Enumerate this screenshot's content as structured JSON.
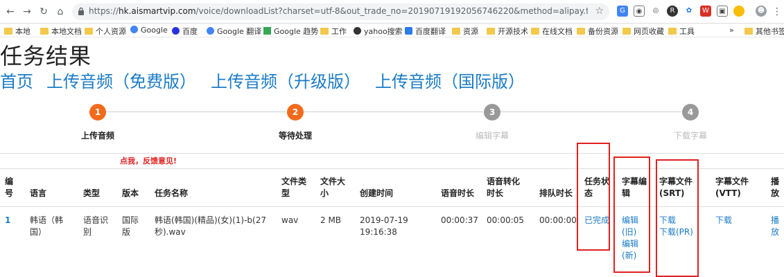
{
  "browser": {
    "url_prefix": "https://",
    "url_host": "hk.aismartvip.com",
    "url_rest": "/voice/downloadList?charset=utf-8&out_trade_no=20190719192056746220&method=alipay.trade.page.pay.return...",
    "bookmarks": [
      "本地",
      "本地文档",
      "个人资源",
      "Google",
      "百度",
      "Google 翻译",
      "Google 趋势",
      "工作",
      "yahoo搜索",
      "百度翻译",
      "资源",
      "开源技术",
      "在线文档",
      "备份资源",
      "网页收藏",
      "工具"
    ],
    "overflow": "»",
    "other_bookmarks": "其他书签"
  },
  "page": {
    "title": "任务结果",
    "nav": [
      "首页",
      "上传音频（免费版）",
      "上传音频（升级版）",
      "上传音频（国际版）"
    ]
  },
  "steps": [
    {
      "num": "1",
      "label": "上传音频",
      "state": "active"
    },
    {
      "num": "2",
      "label": "等待处理",
      "state": "active"
    },
    {
      "num": "3",
      "label": "编辑字幕",
      "state": "inactive"
    },
    {
      "num": "4",
      "label": "下载字幕",
      "state": "inactive"
    }
  ],
  "colors": {
    "accent": "#f26b1d",
    "inactive_step": "#999999",
    "link": "#1a7bc4",
    "highlight": "#e02020"
  },
  "feedback_link": "点我，反馈意见!",
  "table": {
    "headers": {
      "id": [
        "编",
        "号"
      ],
      "language": "语言",
      "type": "类型",
      "version": "版本",
      "task_name": "任务名称",
      "file_type": [
        "文件类",
        "型"
      ],
      "file_size": [
        "文件大",
        "小"
      ],
      "created": "创建时间",
      "audio_duration": "语音时长",
      "convert_duration": [
        "语音转化",
        "时长"
      ],
      "queue_duration": "排队时长",
      "status": [
        "任务状",
        "态"
      ],
      "subtitle_edit": [
        "字幕编",
        "辑"
      ],
      "subtitle_srt": [
        "字幕文件",
        "(SRT)"
      ],
      "subtitle_vtt": [
        "字幕文件",
        "(VTT)"
      ],
      "play": [
        "播",
        "放"
      ]
    },
    "row": {
      "id": "1",
      "language": [
        "韩语（韩",
        "国）"
      ],
      "type": [
        "语音识",
        "别"
      ],
      "version": [
        "国际",
        "版"
      ],
      "task_name": [
        "韩语(韩国)(精品)(女)(1)-b(27",
        "秒).wav"
      ],
      "file_type": "wav",
      "file_size": "2 MB",
      "created": [
        "2019-07-19",
        "19:16:38"
      ],
      "audio_duration": "00:00:37",
      "convert_duration": "00:00:05",
      "queue_duration": "00:00:00",
      "status": "已完成",
      "edit_links": [
        "编辑",
        "(旧)",
        "编辑",
        "(新)"
      ],
      "srt_links": [
        "下载",
        "下载(PR)"
      ],
      "vtt_link": "下载",
      "play_link": [
        "播",
        "放"
      ]
    }
  }
}
